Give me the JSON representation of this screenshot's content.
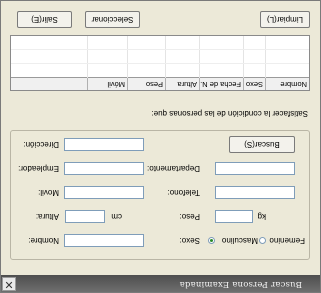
{
  "window": {
    "title": "Buscar Persona Examinada",
    "close_glyph": "✕"
  },
  "group": {
    "fields": {
      "nombre_label": "Nombre:",
      "sexo_label": "Sexo:",
      "sexo_options": [
        "Masculino",
        "Femenino"
      ],
      "sexo_selected": "Masculino",
      "altura_label": "Altura:",
      "altura_unit": "cm",
      "peso_label": "Peso:",
      "peso_unit": "kg",
      "movil_label": "Movil:",
      "telefono_label": "Telefono:",
      "empleador_label": "Empleador:",
      "departamento_label": "Departamento:",
      "direccion_label": "Dirección:"
    },
    "search_button": "Buscar(S)"
  },
  "results": {
    "prompt": "Satisfacer la condición de las personas que:",
    "columns": [
      "Nombre",
      "Sexo",
      "Fecha de N...",
      "Altura",
      "Peso",
      "Móvil"
    ],
    "rows": []
  },
  "footer": {
    "clear_button": "Limpiar(L)",
    "select_button": "Seleccionar",
    "exit_button": "Salir(E)"
  }
}
